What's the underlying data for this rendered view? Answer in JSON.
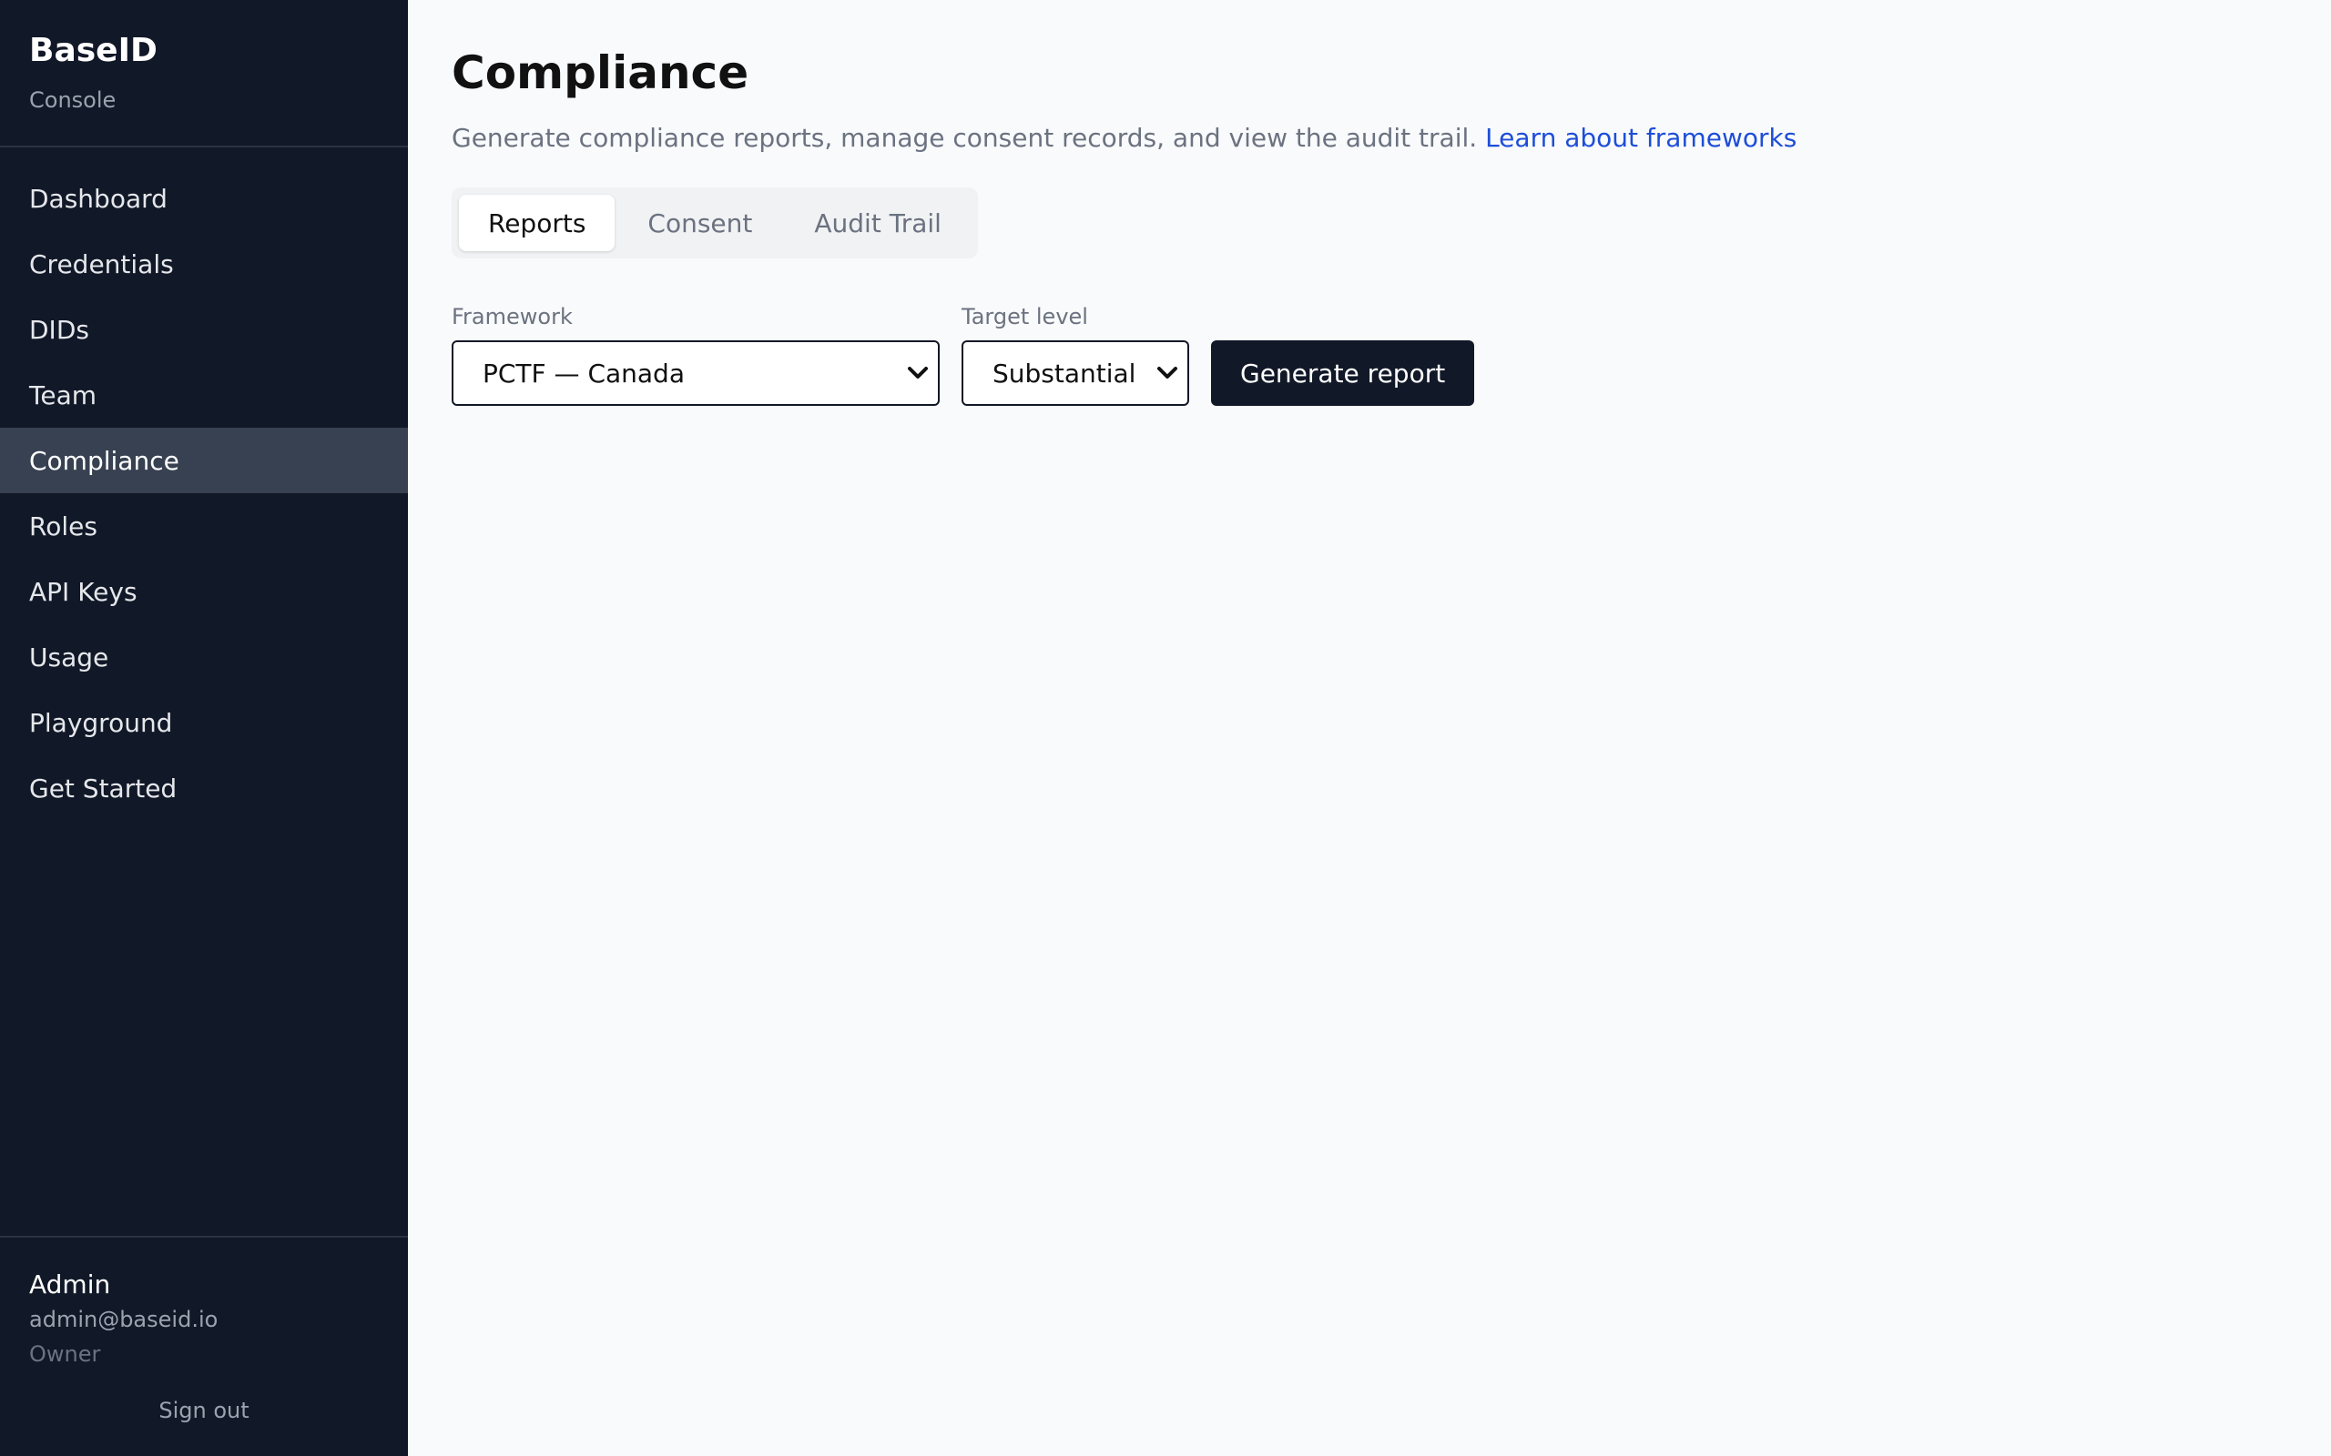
{
  "brand": {
    "name": "BaseID",
    "subtitle": "Console"
  },
  "nav": [
    {
      "label": "Dashboard",
      "active": false
    },
    {
      "label": "Credentials",
      "active": false
    },
    {
      "label": "DIDs",
      "active": false
    },
    {
      "label": "Team",
      "active": false
    },
    {
      "label": "Compliance",
      "active": true
    },
    {
      "label": "Roles",
      "active": false
    },
    {
      "label": "API Keys",
      "active": false
    },
    {
      "label": "Usage",
      "active": false
    },
    {
      "label": "Playground",
      "active": false
    },
    {
      "label": "Get Started",
      "active": false
    }
  ],
  "user": {
    "name": "Admin",
    "email": "admin@baseid.io",
    "role": "Owner",
    "signout_label": "Sign out"
  },
  "page": {
    "title": "Compliance",
    "description": "Generate compliance reports, manage consent records, and view the audit trail.",
    "link_label": "Learn about frameworks"
  },
  "tabs": [
    {
      "label": "Reports",
      "active": true
    },
    {
      "label": "Consent",
      "active": false
    },
    {
      "label": "Audit Trail",
      "active": false
    }
  ],
  "form": {
    "framework_label": "Framework",
    "framework_value": "PCTF — Canada",
    "level_label": "Target level",
    "level_value": "Substantial",
    "generate_label": "Generate report"
  },
  "colors": {
    "sidebar_bg": "#111827",
    "active_nav_bg": "#374151",
    "link": "#1d4ed8",
    "primary_button": "#111827"
  }
}
